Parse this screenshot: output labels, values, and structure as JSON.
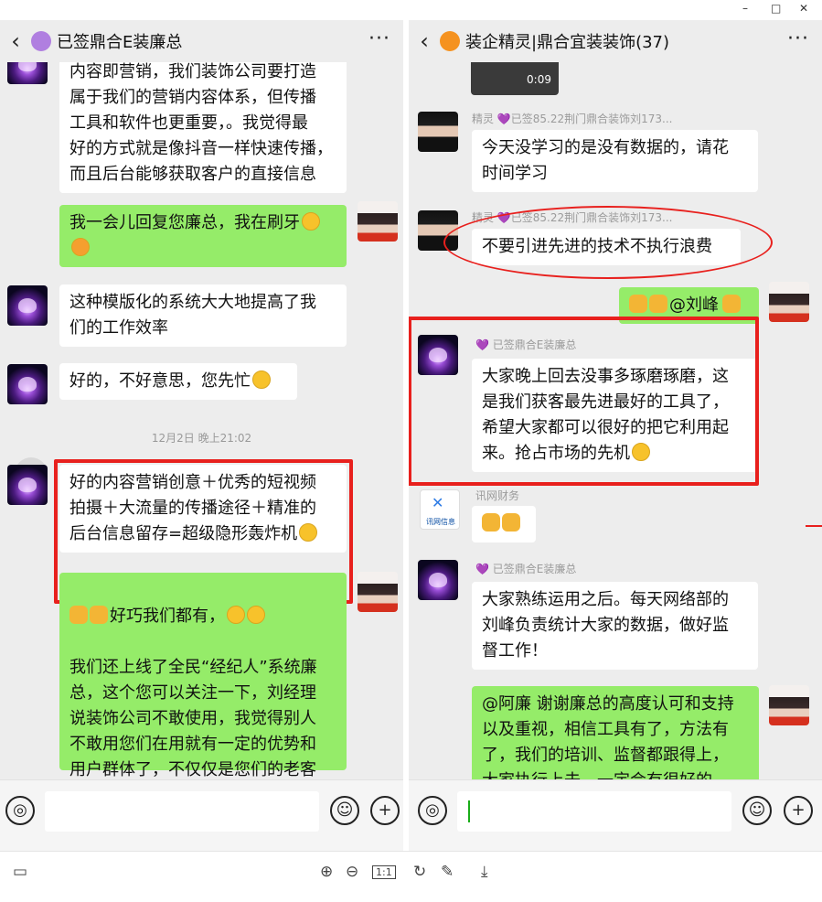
{
  "window": {
    "min": "–",
    "max": "□",
    "close": "✕"
  },
  "left": {
    "title": "已签鼎合E装廉总",
    "heart_color": "#b07fe0",
    "more": "···",
    "messages": [
      {
        "text": "内容即营销，我们装饰公司要打造\n属于我们的营销内容体系，但传播\n工具和软件也更重要，。我觉得最\n好的方式就是像抖音一样快速传播，\n而且后台能够获取客户的直接信息"
      },
      {
        "text": "我一会儿回复您廉总，我在刷牙"
      },
      {
        "text": "这种模版化的系统大大地提高了我\n们的工作效率"
      },
      {
        "text": "好的，不好意思，您先忙"
      },
      {
        "text": "好的内容营销创意＋优秀的短视频\n拍摄＋大流量的传播途径＋精准的\n后台信息留存=超级隐形轰炸机"
      },
      {
        "text": "好巧我们都有，"
      },
      {
        "text": "我们还上线了全民“经纪人”系统廉\n总，这个您可以关注一下，刘经理\n说装饰公司不敢使用，我觉得别人\n不敢用您们在用就有一定的优势和\n用户群体了，不仅仅是您们的老客\n户"
      }
    ],
    "time": "12月2日 晚上21:02"
  },
  "right": {
    "title": "装企精灵|鼎合宜装装饰(37)",
    "heart_color": "#f5921f",
    "more": "···",
    "video_duration": "0:09",
    "messages": [
      {
        "nick": "精灵 💜已签85.22荆门鼎合装饰刘173...",
        "text": "今天没学习的是没有数据的，请花\n时间学习"
      },
      {
        "nick": "精灵 💜已签85.22荆门鼎合装饰刘173...",
        "text": "不要引进先进的技术不执行浪费"
      },
      {
        "text": "@刘峰"
      },
      {
        "nick": "💜 已签鼎合E装廉总",
        "text": "大家晚上回去没事多琢磨琢磨，这\n是我们获客最先进最好的工具了，\n希望大家都可以很好的把它利用起\n来。抢占市场的先机"
      },
      {
        "nick": "讯网财务",
        "avatar_text": "讯网信息"
      },
      {
        "nick": "💜 已签鼎合E装廉总",
        "text": "大家熟练运用之后。每天网络部的\n刘峰负责统计大家的数据，做好监\n督工作！"
      },
      {
        "text": "@阿廉 谢谢廉总的高度认可和支持\n以及重视，相信工具有了，方法有\n了，我们的培训、监督都跟得上，\n大家执行上去，一定会有很好的"
      }
    ]
  },
  "bottom": {
    "icons": [
      "layout-icon",
      "zoom-in-icon",
      "zoom-out-icon",
      "actual-size-icon",
      "rotate-icon",
      "edit-icon",
      "download-icon"
    ],
    "actual_size": "1:1"
  }
}
